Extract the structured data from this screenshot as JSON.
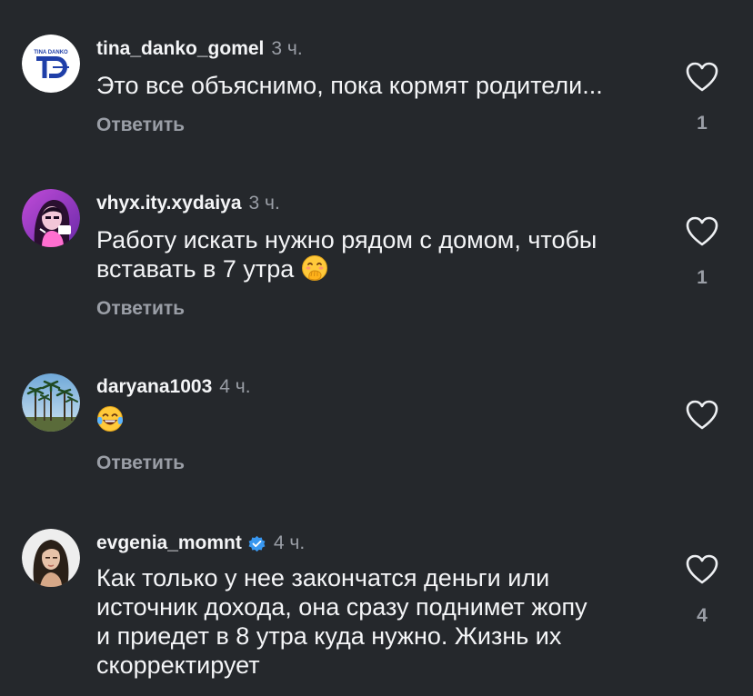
{
  "comments": [
    {
      "username": "tina_danko_gomel",
      "time": "3 ч.",
      "text": "Это все объяснимо, пока кормят родители...",
      "reply_label": "Ответить",
      "likes": "1",
      "avatar_icon": "td-logo-avatar",
      "avatar_text": "TINA DANKO"
    },
    {
      "username": "vhyx.ity.xydaiya",
      "time": "3 ч.",
      "text_line1": "Работу искать нужно рядом с домом, чтобы",
      "text_line2": "вставать в 7 утра",
      "emoji": "face-with-hand-over-mouth-emoji",
      "reply_label": "Ответить",
      "likes": "1",
      "avatar_icon": "illustrated-girl-avatar"
    },
    {
      "username": "daryana1003",
      "time": "4 ч.",
      "emoji": "face-with-tears-of-joy-emoji",
      "reply_label": "Ответить",
      "avatar_icon": "palm-trees-avatar"
    },
    {
      "username": "evgenia_momnt",
      "verified": true,
      "time": "4 ч.",
      "text_line1": "Как только у нее закончатся деньги или",
      "text_line2": "источник дохода, она сразу поднимет жопу",
      "text_line3": "и приедет в 8 утра куда нужно. Жизнь их",
      "text_line4": "скорректирует",
      "likes": "4",
      "avatar_icon": "woman-portrait-avatar"
    }
  ],
  "colors": {
    "background": "#25282c",
    "primary_text": "#f4f5f7",
    "secondary_text": "#9a9ea6",
    "verified_badge": "#3897f0"
  }
}
